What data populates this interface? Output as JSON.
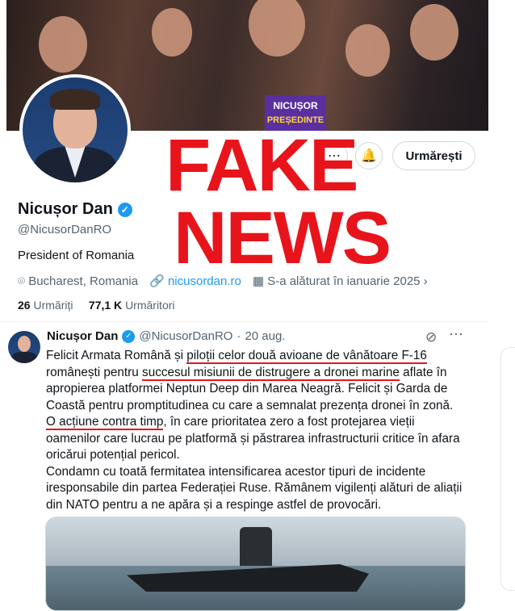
{
  "banner": {
    "sign_line1": "NICUȘOR",
    "sign_line2": "PREȘEDINTE"
  },
  "overlay": {
    "line1": "FAKE",
    "line2": "NEWS",
    "color": "#e8141b"
  },
  "profile": {
    "name": "Nicușor Dan",
    "handle": "@NicusorDanRO",
    "bio": "President of Romania",
    "location": "Bucharest, Romania",
    "website": "nicusordan.ro",
    "joined": "S-a alăturat în ianuarie 2025",
    "following_count": "26",
    "following_label": "Urmăriți",
    "followers_count": "77,1 K",
    "followers_label": "Urmăritori",
    "follow_button": "Urmărești"
  },
  "tweet": {
    "name": "Nicușor Dan",
    "handle": "@NicusorDanRO",
    "dot": "·",
    "date": "20 aug.",
    "t1": "Felicit Armata Română și ",
    "t1u": "piloții celor două avioane de vânătoare F-16",
    "t2": " românești pentru ",
    "t2u": "succesul misiunii de distrugere a dronei marine",
    "t3": " aflate în apropierea platformei Neptun Deep din Marea Neagră. Felicit și Garda de Coastă pentru promptitudinea cu care a semnalat prezența dronei în zonă. ",
    "t4u": "O acțiune contra timp",
    "t5": ", în care prioritatea zero a fost protejarea vieții oamenilor care lucrau pe platformă și păstrarea infrastructurii critice  în afara oricărui potențial pericol.",
    "p2": "Condamn cu toată fermitatea intensificarea acestor tipuri de incidente iresponsabile din partea Federației Ruse. Rămânem vigilenți alături de aliații din NATO pentru a ne apăra și a respinge astfel de provocări."
  },
  "colors": {
    "accent": "#1d9bf0",
    "underline": "#e8141b"
  }
}
